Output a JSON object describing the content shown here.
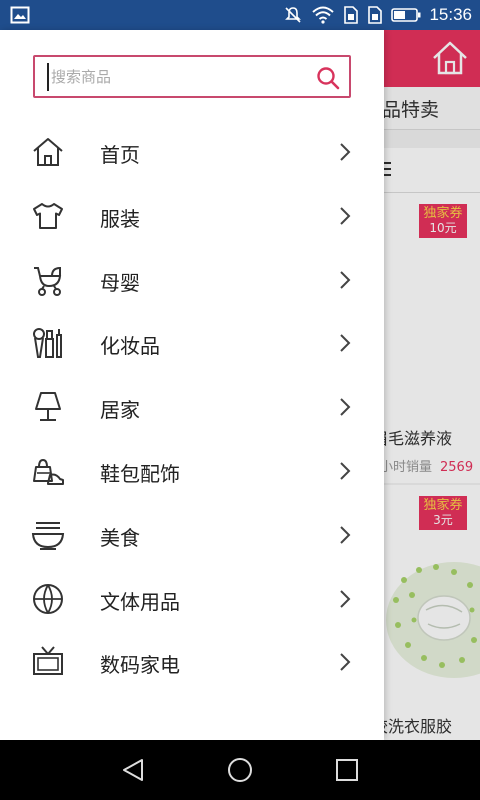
{
  "status_bar": {
    "time": "15:36",
    "icons": [
      "image-icon",
      "mute-icon",
      "wifi-icon",
      "sim1-icon",
      "sim2-icon",
      "battery-icon"
    ]
  },
  "background_app": {
    "tab_label": "品特卖",
    "products": [
      {
        "coupon_title": "独家券",
        "coupon_value": "10元",
        "title": "眉毛滋养液",
        "sales_label": "小时销量",
        "sales_count": "2569"
      },
      {
        "coupon_title": "独家券",
        "coupon_value": "3元",
        "title": "胶洗衣服胶"
      }
    ]
  },
  "drawer": {
    "search": {
      "placeholder": "搜索商品",
      "value": ""
    },
    "menu": [
      {
        "label": "首页",
        "icon": "home-icon"
      },
      {
        "label": "服装",
        "icon": "tshirt-icon"
      },
      {
        "label": "母婴",
        "icon": "stroller-icon"
      },
      {
        "label": "化妆品",
        "icon": "cosmetics-icon"
      },
      {
        "label": "居家",
        "icon": "lamp-icon"
      },
      {
        "label": "鞋包配饰",
        "icon": "shoe-bag-icon"
      },
      {
        "label": "美食",
        "icon": "noodle-bowl-icon"
      },
      {
        "label": "文体用品",
        "icon": "ball-icon"
      },
      {
        "label": "数码家电",
        "icon": "tv-icon"
      }
    ]
  },
  "colors": {
    "accent": "#e8335e",
    "search_border": "#c8496e",
    "status_bar": "#1f4d8c",
    "nav_bar": "#000000"
  }
}
